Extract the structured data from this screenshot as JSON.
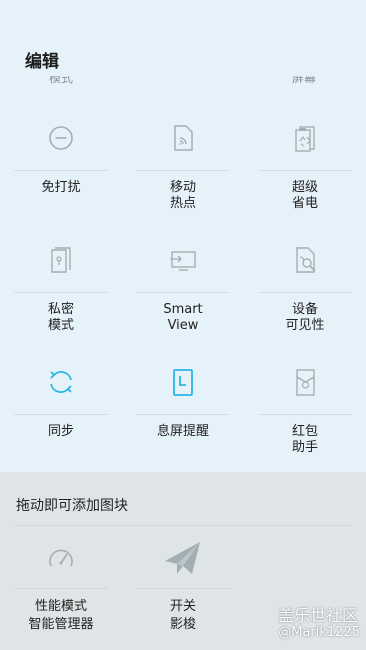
{
  "header": {
    "title": "编辑"
  },
  "partials": {
    "left": "模式",
    "right": "屏幕"
  },
  "tiles": [
    {
      "icon": "do-not-disturb-icon",
      "label": "免打扰"
    },
    {
      "icon": "mobile-hotspot-icon",
      "label": "移动\n热点"
    },
    {
      "icon": "ultra-power-saving-icon",
      "label": "超级\n省电"
    },
    {
      "icon": "private-mode-icon",
      "label": "私密\n模式"
    },
    {
      "icon": "smart-view-icon",
      "label": "Smart\nView"
    },
    {
      "icon": "device-visibility-icon",
      "label": "设备\n可见性"
    },
    {
      "icon": "sync-icon",
      "label": "同步"
    },
    {
      "icon": "always-on-display-icon",
      "label": "息屏提醒"
    },
    {
      "icon": "red-envelope-icon",
      "label": "红包\n助手"
    }
  ],
  "drag": {
    "title": "拖动即可添加图块",
    "items": [
      {
        "icon": "speedometer-icon",
        "label": "性能模式",
        "sub": "智能管理器"
      },
      {
        "icon": "paper-plane-icon",
        "label": "开关",
        "sub": "影梭"
      }
    ]
  },
  "watermark": {
    "line1": "盖乐世社区",
    "line2": "@Marik1225"
  },
  "colors": {
    "accent": "#29b6e6",
    "icon_gray": "#a7adb1",
    "tile_bg": "#e6f2f9",
    "drag_bg": "#dfe5e6"
  }
}
